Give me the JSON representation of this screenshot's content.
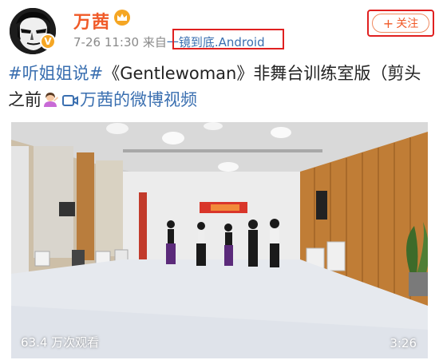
{
  "user": {
    "name": "万茜",
    "verified_badge": "V",
    "avatar_icon": "avatar-illustration-icon",
    "level_icon": "crown-icon"
  },
  "meta": {
    "date": "7-26",
    "time": "11:30",
    "from_prefix": "来自",
    "source": "一镜到底.Android"
  },
  "follow": {
    "plus": "+",
    "label": "关注"
  },
  "post": {
    "tag": "#听姐姐说#",
    "text_1": "《Gentlewoman》非舞台训练室版（剪头之前",
    "emoji_icon": "woman-emoji-icon",
    "video_link_icon": "video-camera-icon",
    "video_link": "万茜的微博视频"
  },
  "video": {
    "views": "63.4 万次观看",
    "duration": "3:26"
  },
  "colors": {
    "brand_orange": "#f05a28",
    "link_blue": "#3a6fb0",
    "highlight_red": "#e02020"
  }
}
